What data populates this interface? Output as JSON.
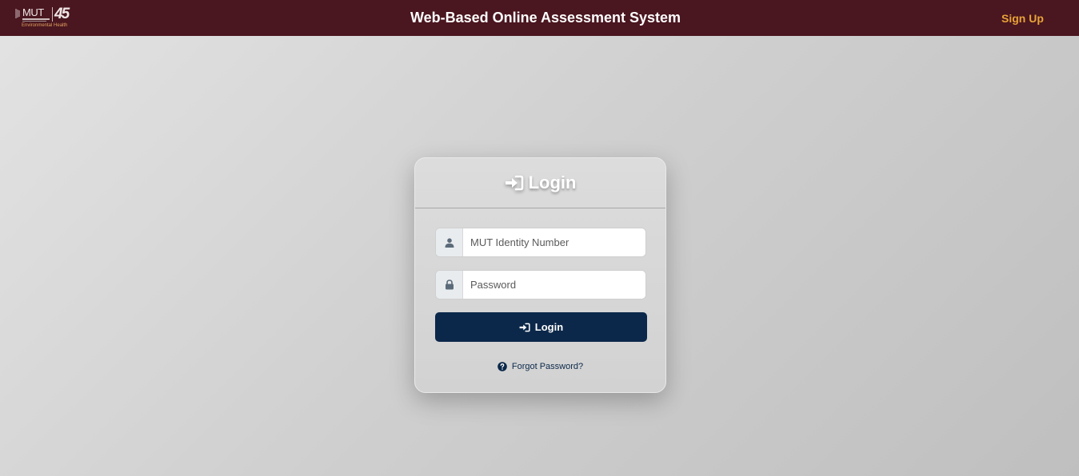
{
  "navbar": {
    "logo": {
      "brand": "MUT",
      "years": "45",
      "department": "Environmental Health"
    },
    "title": "Web-Based Online Assessment System",
    "signup_label": "Sign Up"
  },
  "login_card": {
    "title": "Login",
    "identity_field": {
      "placeholder": "MUT Identity Number",
      "value": "",
      "icon": "user-icon"
    },
    "password_field": {
      "placeholder": "Password",
      "value": "",
      "icon": "lock-icon"
    },
    "submit_label": "Login",
    "forgot_label": "Forgot Password?"
  },
  "colors": {
    "navbar_bg": "#4a161f",
    "signup_accent": "#e8a33a",
    "primary_button": "#0b284a"
  }
}
